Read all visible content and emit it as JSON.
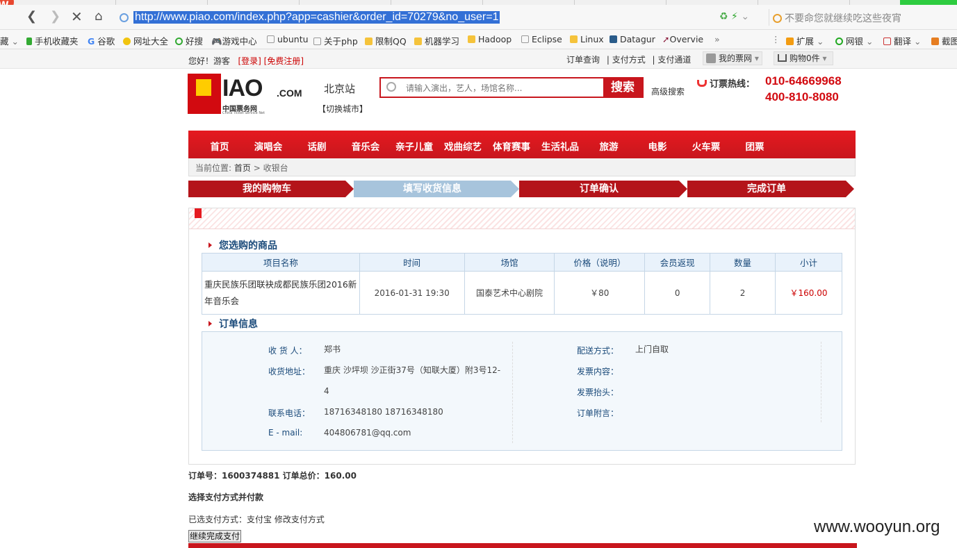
{
  "browser": {
    "logo_letter": "W",
    "url": "http://www.piao.com/index.php?app=cashier&order_id=70279&no_user=1",
    "search_placeholder": "不要命您就继续吃这些夜宵",
    "bookmarks": [
      "藏",
      "手机收藏夹",
      "谷歌",
      "网址大全",
      "好搜",
      "游戏中心",
      "ubuntu",
      "关于php",
      "限制QQ",
      "机器学习",
      "Hadoop",
      "Eclipse",
      "Linux",
      "Datagur",
      "Overvie",
      "»"
    ],
    "right_tools": [
      "扩展",
      "网银",
      "翻译",
      "截图"
    ]
  },
  "topbar": {
    "greeting": "您好！游客",
    "login": "[登录]",
    "register": "[免费注册]",
    "links": [
      "订单查询",
      "| 支付方式",
      "| 支付通道"
    ],
    "my_account": "我的票网",
    "cart": "购物0件"
  },
  "header": {
    "logo_iao": "IAO",
    "logo_com": ".COM",
    "logo_cn": "中国票务网",
    "logo_en": "China Ticket Service Net",
    "city": "北京站",
    "switch_city": "【切换城市】",
    "search_placeholder": "请输入演出，艺人，场馆名称...",
    "search_button": "搜索",
    "advanced_search": "高级搜索",
    "hotline_label": "订票热线：",
    "tel1": "010-64669968",
    "tel2": "400-810-8080"
  },
  "nav": [
    "首页",
    "演唱会",
    "话剧",
    "音乐会",
    "亲子儿童",
    "戏曲综艺",
    "体育赛事",
    "生活礼品",
    "旅游",
    "电影",
    "火车票",
    "团票"
  ],
  "breadcrumb": {
    "prefix": "当前位置:",
    "home": "首页",
    "current": "> 收银台"
  },
  "steps": [
    {
      "label": "我的购物车",
      "active": false
    },
    {
      "label": "填写收货信息",
      "active": true
    },
    {
      "label": "订单确认",
      "active": false
    },
    {
      "label": "完成订单",
      "active": false
    }
  ],
  "goods_section": {
    "title": "您选购的商品",
    "headers": [
      "项目名称",
      "时间",
      "场馆",
      "价格（说明）",
      "会员返现",
      "数量",
      "小计"
    ],
    "row": {
      "name": "重庆民族乐团联袂成都民族乐团2016新年音乐会",
      "time": "2016-01-31 19:30",
      "venue": "国泰艺术中心剧院",
      "price": "￥80",
      "cashback": "0",
      "qty": "2",
      "subtotal": "￥160.00"
    }
  },
  "order_section": {
    "title": "订单信息",
    "receiver_label": "收 货 人：",
    "receiver": "郑书",
    "address_label": "收货地址：",
    "address": "重庆 沙坪坝 沙正街37号（知联大厦）附3号12-4",
    "phone_label": "联系电话：",
    "phone": "18716348180 18716348180",
    "email_label": "E - mail:",
    "email": "404806781@qq.com",
    "delivery_label": "配送方式：",
    "delivery": "上门自取",
    "invoice_content_label": "发票内容：",
    "invoice_title_label": "发票抬头：",
    "note_label": "订单附言："
  },
  "summary": "订单号：1600374881 订单总价：160.00",
  "payment": {
    "title": "选择支付方式并付款",
    "selected": "已选支付方式：支付宝 修改支付方式",
    "button": "继续完成支付"
  },
  "watermark": "www.wooyun.org",
  "colors": {
    "brand_red": "#c8161d",
    "active_step": "#a7c4dc",
    "table_header_bg": "#e9f2fb"
  }
}
